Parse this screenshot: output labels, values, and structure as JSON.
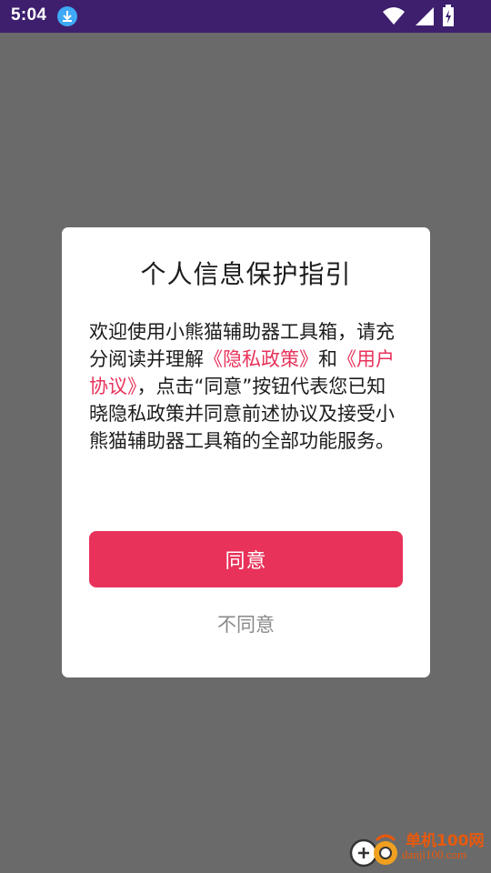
{
  "status_bar": {
    "time": "5:04",
    "icons": [
      "download-icon",
      "wifi-icon",
      "signal-icon",
      "battery-charging-icon"
    ]
  },
  "dialog": {
    "title": "个人信息保护指引",
    "body": {
      "part1": "欢迎使用小熊猫辅助器工具箱，请充分阅读并理解",
      "privacy_link": "《隐私政策》",
      "part2": "和",
      "agreement_link": "《用户协议》",
      "part3": "，点击“同意”按钮代表您已知晓隐私政策并同意前述协议及接受小熊猫辅助器工具箱的全部功能服务。"
    },
    "agree_label": "同意",
    "disagree_label": "不同意"
  },
  "watermark": {
    "name": "单机100网",
    "domain": "danji100.com"
  },
  "colors": {
    "status_bar": "#3d1f6e",
    "overlay": "#6a6a6a",
    "accent": "#e8325a",
    "secondary_text": "#8a8a8a"
  }
}
